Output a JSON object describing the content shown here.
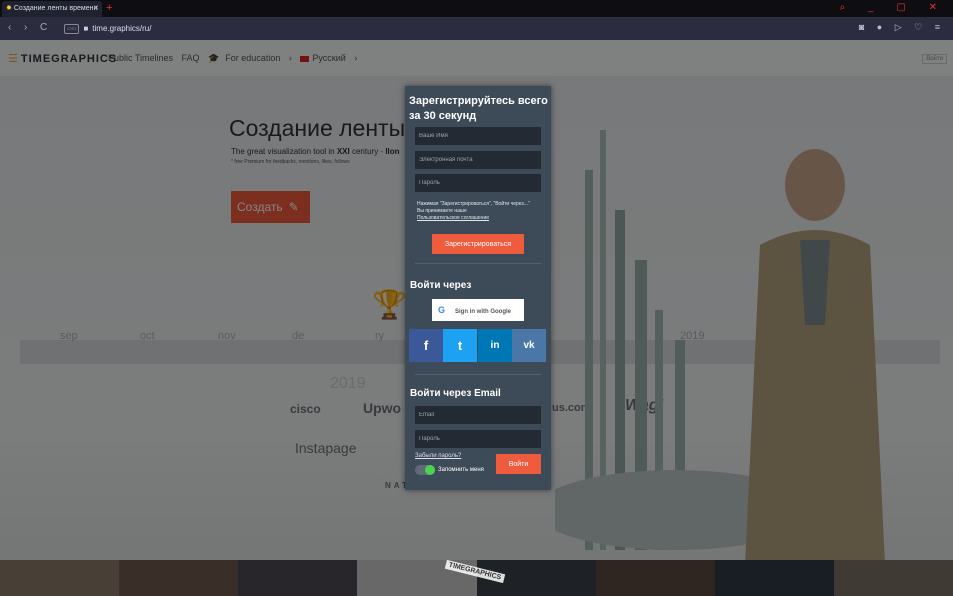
{
  "browser": {
    "tab_title": "Создание ленты времени",
    "tab_close": "✕",
    "new_tab": "+",
    "url": "time.graphics/ru/",
    "window_controls": "⌕ _ ▢ ✕",
    "nav_icons": "◙ ● ▷ ♡ ≡"
  },
  "site": {
    "logo_prefix": "TIME",
    "logo_suffix": "GRAPHICS",
    "menu": {
      "public_timelines": "Public Timelines",
      "faq": "FAQ",
      "education": "For education",
      "language": "Русский"
    },
    "login_small": "Войти"
  },
  "hero": {
    "title": "Создание ленты вр",
    "subtitle_pre": "The great visualization tool in ",
    "subtitle_bold": "XXI",
    "subtitle_post": " century - ",
    "subtitle_tail": "Ilon",
    "note": "* free Premium for feedbacks, mentions, likes, follows",
    "create_label": "Создать"
  },
  "background": {
    "timeline_labels": [
      "sep",
      "oct",
      "nov",
      "de",
      "ry"
    ],
    "timeline_label_right": "2019",
    "year": "2019",
    "brands": [
      "cisco",
      "Upwo",
      "Instapage",
      "us.com",
      "Wag!",
      "NATUREBOX"
    ]
  },
  "modal": {
    "title": "Зарегистрируйтесь всего за 30 секунд",
    "name_placeholder": "Ваше Имя",
    "email_placeholder": "Электронная почта",
    "password_placeholder": "Пароль",
    "terms_text": "Нажимая \"Зарегистрироваться\", \"Войти через...\" Вы принимаете наше",
    "terms_link": "Пользовательское соглашение",
    "register_label": "Зарегистрироваться",
    "login_via_title": "Войти через",
    "google_label": "Sign in with Google",
    "social_facebook": "f",
    "social_twitter": "t",
    "social_linkedin": "in",
    "social_vk": "vk",
    "email_login_title": "Войти через Email",
    "email_placeholder2": "Email",
    "password_placeholder2": "Пароль",
    "forgot_label": "Забыли пароль?",
    "remember_label": "Запомнить меня",
    "remember_on": true,
    "login_label": "Войти"
  },
  "strip": {
    "logo": "TIMEGRAPHICS"
  },
  "colors": {
    "accent_orange": "#ef5b3d",
    "facebook": "#3b5998",
    "twitter": "#1da1f2",
    "linkedin": "#0077b5",
    "vk": "#4a76a8",
    "modal_bg": "#3d4a58"
  }
}
